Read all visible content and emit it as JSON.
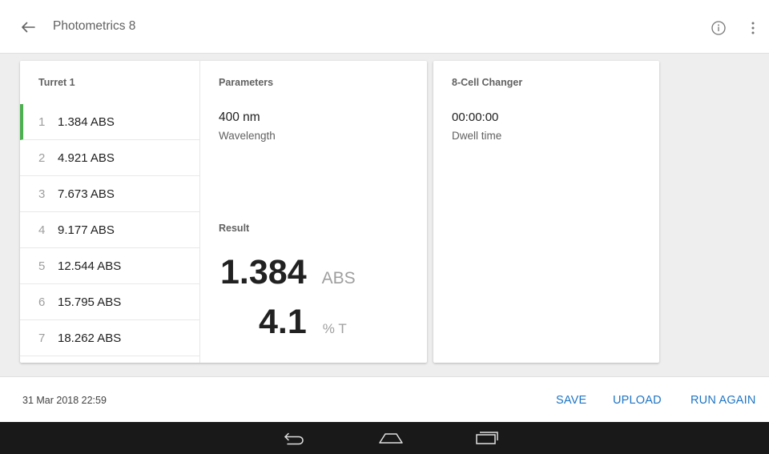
{
  "app_bar": {
    "title": "Photometrics 8",
    "icons": {
      "back": "arrow-back-icon",
      "info": "info-icon",
      "more": "more-vert-icon"
    }
  },
  "turret": {
    "title": "Turret 1",
    "active_index": 0,
    "items": [
      {
        "index": "1",
        "value": "1.384 ABS"
      },
      {
        "index": "2",
        "value": "4.921 ABS"
      },
      {
        "index": "3",
        "value": "7.673 ABS"
      },
      {
        "index": "4",
        "value": "9.177 ABS"
      },
      {
        "index": "5",
        "value": "12.544 ABS"
      },
      {
        "index": "6",
        "value": "15.795 ABS"
      },
      {
        "index": "7",
        "value": "18.262 ABS"
      }
    ]
  },
  "parameters": {
    "title": "Parameters",
    "wavelength_value": "400 nm",
    "wavelength_label": "Wavelength"
  },
  "result": {
    "title": "Result",
    "abs_value": "1.384",
    "abs_unit": "ABS",
    "t_value": "4.1",
    "t_unit": "% T"
  },
  "changer": {
    "title": "8-Cell Changer",
    "dwell_value": "00:00:00",
    "dwell_label": "Dwell time"
  },
  "bottom_bar": {
    "timestamp": "31 Mar 2018 22:59",
    "save_label": "SAVE",
    "upload_label": "UPLOAD",
    "run_again_label": "RUN AGAIN"
  },
  "nav_bar": {
    "icons": {
      "back": "nav-back-icon",
      "home": "nav-home-icon",
      "recents": "nav-recents-icon"
    }
  },
  "colors": {
    "accent_blue": "#1e74c4",
    "active_indicator": "#4caf50",
    "background": "#eeeeee",
    "nav_bar": "#191919"
  }
}
